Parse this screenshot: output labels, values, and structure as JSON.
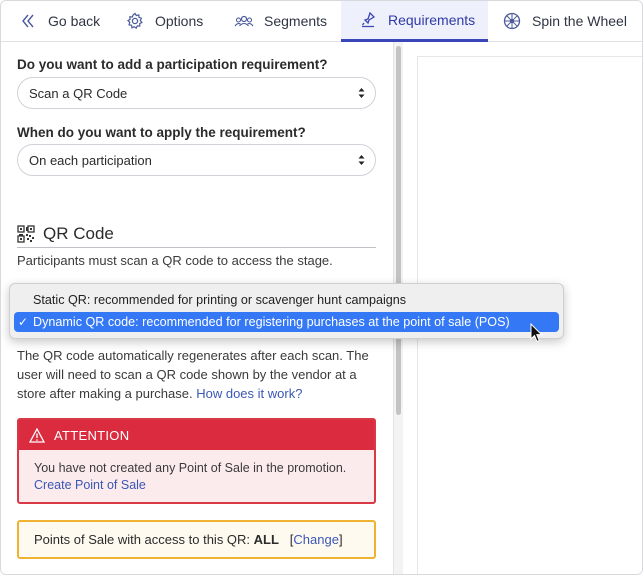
{
  "nav": {
    "back": "Go back",
    "options": "Options",
    "segments": "Segments",
    "requirements": "Requirements",
    "spin": "Spin the Wheel",
    "active_color": "#3a46b8"
  },
  "form": {
    "q1_label": "Do you want to add a participation requirement?",
    "q1_value": "Scan a QR Code",
    "q2_label": "When do you want to apply the requirement?",
    "q2_value": "On each participation"
  },
  "qr": {
    "title": "QR Code",
    "description": "Participants must scan a QR code to access the stage.",
    "paragraph": "The QR code automatically regenerates after each scan. The user will need to scan a QR code shown by the vendor at a store after making a purchase.",
    "paragraph_link": "How does it work?"
  },
  "dropdown": {
    "options": [
      "Static QR: recommended for printing or scavenger hunt campaigns",
      "Dynamic QR code: recommended for registering purchases at the point of sale (POS)"
    ],
    "selected_mark": "✓",
    "highlight_color": "#3478f6"
  },
  "alert": {
    "title": "ATTENTION",
    "body": "You have not created any Point of Sale in the promotion.",
    "link": "Create Point of Sale",
    "color": "#da2b3f"
  },
  "pos": {
    "label": "Points of Sale with access to this QR: ",
    "value": "ALL",
    "bracket_open": "   [",
    "change": "Change",
    "bracket_close": "]",
    "border_color": "#f0b232"
  }
}
